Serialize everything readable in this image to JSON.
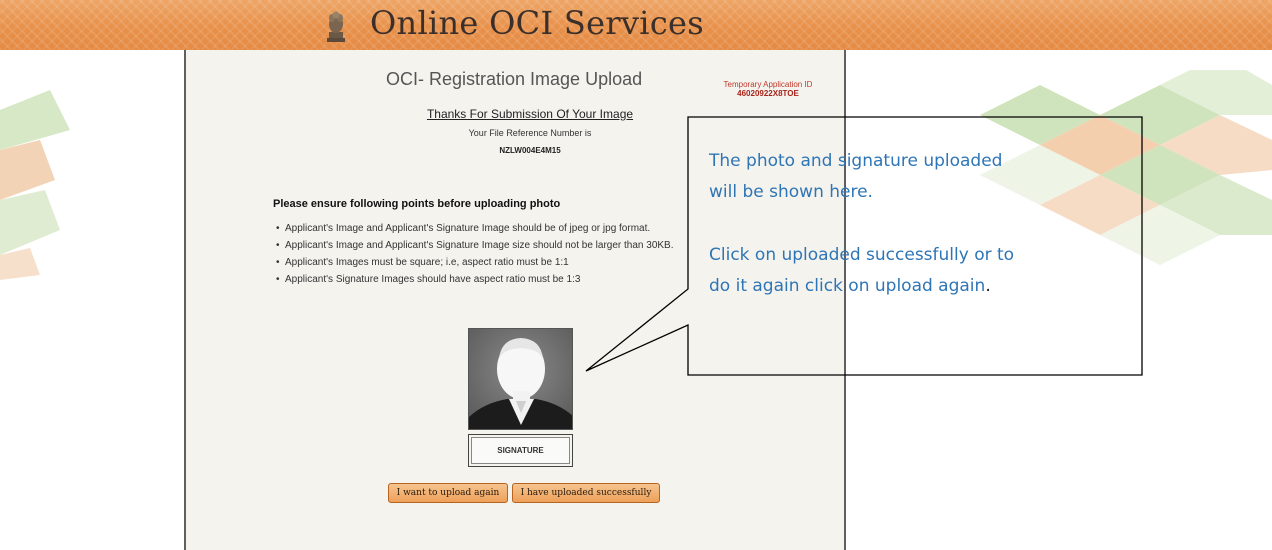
{
  "header": {
    "site_title": "Online OCI Services",
    "emblem_icon": "national-emblem-icon",
    "colors": {
      "band": "#e8914a",
      "title": "#3a2f2a"
    }
  },
  "page": {
    "title": "OCI- Registration Image Upload",
    "temp_id_label": "Temporary Application ID",
    "temp_id_value": "46020922X8TOE",
    "thanks_text": "Thanks For Submission Of Your Image",
    "ref_label": "Your File Reference Number is",
    "ref_value": "NZLW004E4M15",
    "ensure_heading": "Please ensure following points before uploading photo",
    "points": [
      "Applicant's Image and Applicant's Signature Image should be of jpeg or jpg format.",
      "Applicant's Image and Applicant's Signature Image size should not be larger than 30KB.",
      "Applicant's Images must be square; i.e, aspect ratio must be 1:1",
      "Applicant's Signature Images should have aspect ratio must be 1:3"
    ],
    "signature_label": "SIGNATURE",
    "buttons": {
      "upload_again": "I want to upload again",
      "uploaded_successfully": "I have uploaded successfully"
    },
    "colors": {
      "panel": "#f4f3ee",
      "temp_id": "#c0392b",
      "button": "#eea05a"
    }
  },
  "callout": {
    "line1": "The photo and signature uploaded",
    "line2": "will be shown here.",
    "line3": "Click on uploaded successfully or to",
    "line4": "do it again click on upload again",
    "line4_end": ".",
    "color": "#2e75b6"
  }
}
